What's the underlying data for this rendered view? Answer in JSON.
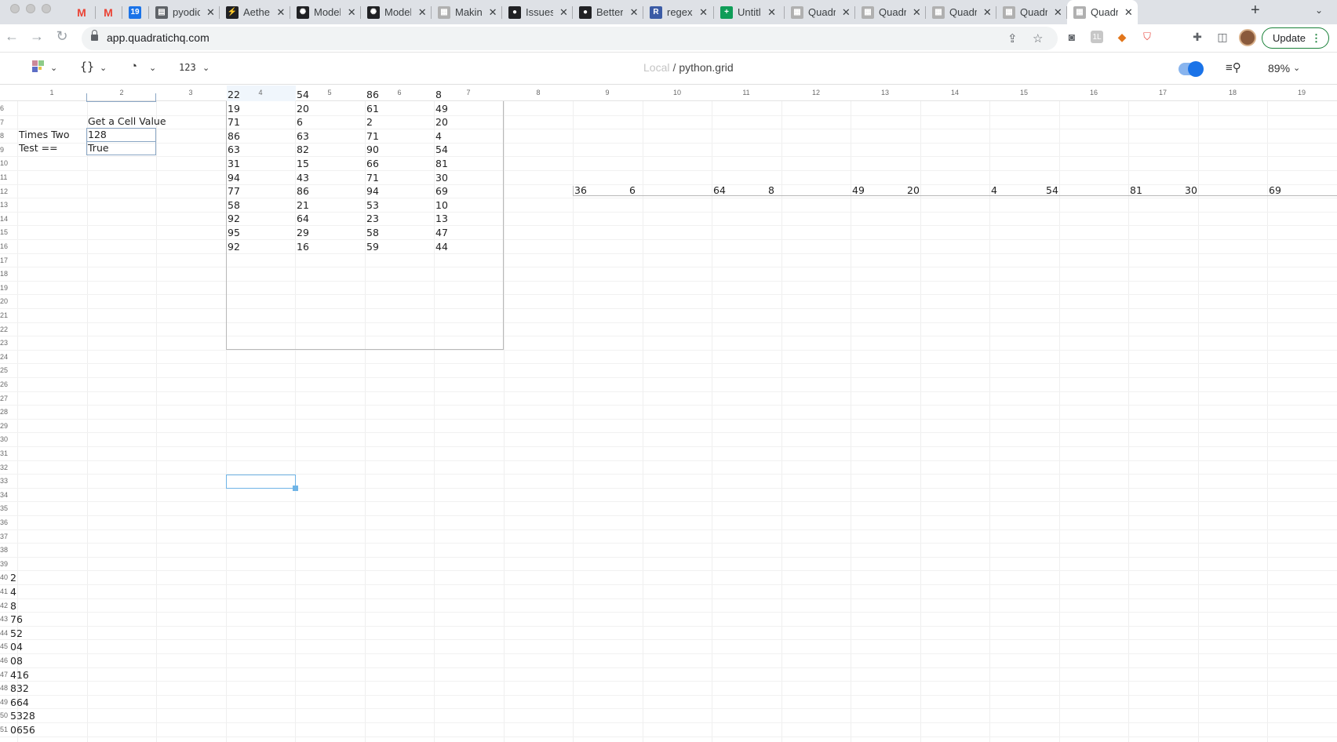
{
  "browser": {
    "tabs": [
      {
        "title": "",
        "favicon": "gmail-icon",
        "color": "#ea4335",
        "glyph": "M"
      },
      {
        "title": "",
        "favicon": "gmail-icon",
        "color": "#ea4335",
        "glyph": "M"
      },
      {
        "title": "",
        "favicon": "calendar-icon",
        "color": "#1a73e8",
        "glyph": "19"
      },
      {
        "title": "pyodic",
        "favicon": "doc-icon",
        "color": "#5f6368",
        "glyph": "▤"
      },
      {
        "title": "Aethe",
        "favicon": "bolt-icon",
        "color": "#202124",
        "glyph": "⚡"
      },
      {
        "title": "Model",
        "favicon": "openai-icon",
        "color": "#202124",
        "glyph": "✺"
      },
      {
        "title": "Model",
        "favicon": "openai-icon",
        "color": "#202124",
        "glyph": "✺"
      },
      {
        "title": "Makin",
        "favicon": "quadratic-icon",
        "color": "#b0b0b0",
        "glyph": "▦"
      },
      {
        "title": "Issues",
        "favicon": "github-icon",
        "color": "#202124",
        "glyph": "●"
      },
      {
        "title": "Better",
        "favicon": "github-icon",
        "color": "#202124",
        "glyph": "●"
      },
      {
        "title": "regex",
        "favicon": "r-icon",
        "color": "#3b5ba5",
        "glyph": "R"
      },
      {
        "title": "Untitl",
        "favicon": "sheets-icon",
        "color": "#0f9d58",
        "glyph": "+"
      },
      {
        "title": "Quadr",
        "favicon": "quadratic-icon",
        "color": "#b0b0b0",
        "glyph": "▦"
      },
      {
        "title": "Quadr",
        "favicon": "quadratic-icon",
        "color": "#b0b0b0",
        "glyph": "▦"
      },
      {
        "title": "Quadr",
        "favicon": "quadratic-icon",
        "color": "#b0b0b0",
        "glyph": "▦"
      },
      {
        "title": "Quadr",
        "favicon": "quadratic-icon",
        "color": "#b0b0b0",
        "glyph": "▦"
      },
      {
        "title": "Quadr",
        "favicon": "quadratic-icon",
        "color": "#b0b0b0",
        "glyph": "▦",
        "active": true
      }
    ],
    "url": "app.quadratichq.com",
    "update_label": "Update"
  },
  "app": {
    "doc_location": "Local",
    "doc_separator": "/",
    "doc_name": "python.grid",
    "zoom": "89%",
    "format_label": "123"
  },
  "grid": {
    "column_headers": [
      "1",
      "2",
      "3",
      "4",
      "5",
      "6",
      "7",
      "8",
      "9",
      "10",
      "11",
      "12",
      "13",
      "14",
      "15",
      "16",
      "17",
      "18",
      "19"
    ],
    "row_headers": [
      "6",
      "7",
      "8",
      "9",
      "10",
      "11",
      "12",
      "13",
      "14",
      "15",
      "16",
      "17",
      "18",
      "19",
      "20",
      "21",
      "22",
      "23",
      "24",
      "25",
      "26",
      "27",
      "28",
      "29",
      "30",
      "31",
      "32",
      "33",
      "34",
      "35",
      "36",
      "37",
      "38",
      "39",
      "40",
      "41",
      "42",
      "43",
      "44",
      "45",
      "46",
      "47",
      "48",
      "49",
      "50",
      "51"
    ],
    "labels": {
      "get_cell_value": "Get a Cell Value",
      "times_two": "Times Two",
      "times_two_value": "128",
      "test_eq": "Test ==",
      "test_value": "True"
    },
    "table_rows": [
      [
        "22",
        "54",
        "86",
        "8"
      ],
      [
        "19",
        "20",
        "61",
        "49"
      ],
      [
        "71",
        "6",
        "2",
        "20"
      ],
      [
        "86",
        "63",
        "71",
        "4"
      ],
      [
        "63",
        "82",
        "90",
        "54"
      ],
      [
        "31",
        "15",
        "66",
        "81"
      ],
      [
        "94",
        "43",
        "71",
        "30"
      ],
      [
        "77",
        "86",
        "94",
        "69"
      ],
      [
        "58",
        "21",
        "53",
        "10"
      ],
      [
        "92",
        "64",
        "23",
        "13"
      ],
      [
        "95",
        "29",
        "58",
        "47"
      ],
      [
        "92",
        "16",
        "59",
        "44"
      ]
    ],
    "spill_row": [
      "36",
      "6",
      "64",
      "8",
      "49",
      "20",
      "4",
      "54",
      "81",
      "30",
      "69"
    ],
    "col1_values": [
      "2",
      "4",
      "8",
      "76",
      "52",
      "04",
      "08",
      "416",
      "832",
      "664",
      "5328",
      "0656"
    ]
  }
}
